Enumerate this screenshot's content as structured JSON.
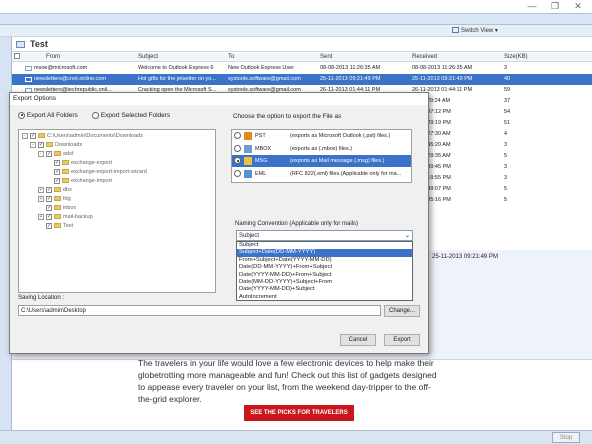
{
  "window": {
    "min": "—",
    "restore": "❐",
    "close": "✕"
  },
  "toolbar": {
    "switch_view": "Switch View"
  },
  "grid": {
    "title": "Test",
    "columns": [
      "From",
      "Subject",
      "To",
      "Sent",
      "Received",
      "Size(KB)"
    ],
    "rows": [
      {
        "from": "msoe@microsoft.com",
        "subject": "Welcome to Outlook Express 6",
        "to": "New Outlook Express User",
        "sent": "08-08-2013 11:26:35 AM",
        "received": "08-08-2013 11:26:35 AM",
        "size": "3",
        "selected": false
      },
      {
        "from": "newsletters@cnet.online.com",
        "subject": "Hot gifts for the jetsetter on yo...",
        "to": "systools.software@gmail.com",
        "sent": "25-11-2013 09:21:49 PM",
        "received": "25-11-2013 09:21:49 PM",
        "size": "40",
        "selected": true
      },
      {
        "from": "newsletters@techrepublic.onli...",
        "subject": "Cracking open the Microsoft S...",
        "to": "systools.software@gmail.com",
        "sent": "26-11-2013 01:44:11 PM",
        "received": "26-11-2013 01:44:11 PM",
        "size": "59",
        "selected": false
      },
      {
        "from": "",
        "subject": "",
        "to": "",
        "sent": "",
        "received": "13 11:29:24 AM",
        "size": "37",
        "selected": false
      },
      {
        "from": "",
        "subject": "",
        "to": "",
        "sent": "",
        "received": "13 07:07:12 PM",
        "size": "54",
        "selected": false
      },
      {
        "from": "",
        "subject": "",
        "to": "",
        "sent": "",
        "received": "13 07:29:19 PM",
        "size": "51",
        "selected": false
      },
      {
        "from": "",
        "subject": "",
        "to": "",
        "sent": "",
        "received": "13 12:27:30 AM",
        "size": "4",
        "selected": false
      },
      {
        "from": "",
        "subject": "",
        "to": "",
        "sent": "",
        "received": "13 12:45:20 AM",
        "size": "3",
        "selected": false
      },
      {
        "from": "",
        "subject": "",
        "to": "",
        "sent": "",
        "received": "13 01:29:35 AM",
        "size": "5",
        "selected": false
      },
      {
        "from": "",
        "subject": "",
        "to": "",
        "sent": "",
        "received": "13 01:39:45 PM",
        "size": "3",
        "selected": false
      },
      {
        "from": "",
        "subject": "",
        "to": "",
        "sent": "",
        "received": "13 03:19:55 PM",
        "size": "3",
        "selected": false
      },
      {
        "from": "",
        "subject": "",
        "to": "",
        "sent": "",
        "received": "13 08:49:07 PM",
        "size": "5",
        "selected": false
      },
      {
        "from": "",
        "subject": "",
        "to": "",
        "sent": "",
        "received": "13 02:05:16 PM",
        "size": "5",
        "selected": false
      }
    ]
  },
  "preview": {
    "received": "25-11-2013 09:21:49 PM",
    "body": "The travelers in your life would love a few electronic devices to help make their globetrotting more manageable and fun! Check out this list of gadgets designed to appease every traveler on your list, from the weekend day-tripper to the off-the-grid explorer.",
    "cta": "SEE THE PICKS FOR TRAVELERS"
  },
  "statusbar": {
    "stop": "Stop"
  },
  "dialog": {
    "title": "Export Options",
    "export_all": "Export All Folders",
    "export_selected": "Export Selected Folders",
    "choose_label": "Choose the option to export the File as",
    "tree": [
      {
        "label": "C:\\Users\\admin\\Documents\\Downloads",
        "level": 0,
        "exp": "-"
      },
      {
        "label": "Downloads",
        "level": 1,
        "exp": "-"
      },
      {
        "label": "adsf",
        "level": 2,
        "exp": "-"
      },
      {
        "label": "exchange-export",
        "level": 3,
        "exp": ""
      },
      {
        "label": "exchange-export-import-wizard",
        "level": 3,
        "exp": ""
      },
      {
        "label": "exchange-import",
        "level": 3,
        "exp": ""
      },
      {
        "label": "dbx",
        "level": 2,
        "exp": "+"
      },
      {
        "label": "fdg",
        "level": 2,
        "exp": "+"
      },
      {
        "label": "inbox",
        "level": 2,
        "exp": ""
      },
      {
        "label": "mail-backup",
        "level": 2,
        "exp": "+"
      },
      {
        "label": "Test",
        "level": 2,
        "exp": ""
      }
    ],
    "formats": [
      {
        "name": "PST",
        "desc": "(exports as Microsoft Outlook (.pst) files.)",
        "selected": false,
        "color": "#e08a1e"
      },
      {
        "name": "MBOX",
        "desc": "(exports as (.mbox) files.)",
        "selected": false,
        "color": "#6f9bd1"
      },
      {
        "name": "MSG",
        "desc": "(exports as Mail message (.msg) files.)",
        "selected": true,
        "color": "#f0c040"
      },
      {
        "name": "EML",
        "desc": "(RFC 822(.eml) files.(Applicable only for ma...",
        "selected": false,
        "color": "#5b8fd6"
      }
    ],
    "naming_label": "Naming Convention (Applicable only for mails)",
    "naming_value": "Subject",
    "naming_options": [
      "Subject",
      "Subject+Date(DD-MM-YYYY)",
      "From+Subject+Date(YYYY-MM-DD)",
      "Date(DD-MM-YYYY)+From+Subject",
      "Date(YYYY-MM-DD)+From+Subject",
      "Date(MM-DD-YYYY)+Subject+From",
      "Date(YYYY-MM-DD)+Subject",
      "AutoIncrement"
    ],
    "naming_selected": 1,
    "saving_label": "Saving Location :",
    "saving_path": "C:\\Users\\admin\\Desktop",
    "change_btn": "Change...",
    "cancel_btn": "Cancel",
    "export_btn": "Export"
  }
}
